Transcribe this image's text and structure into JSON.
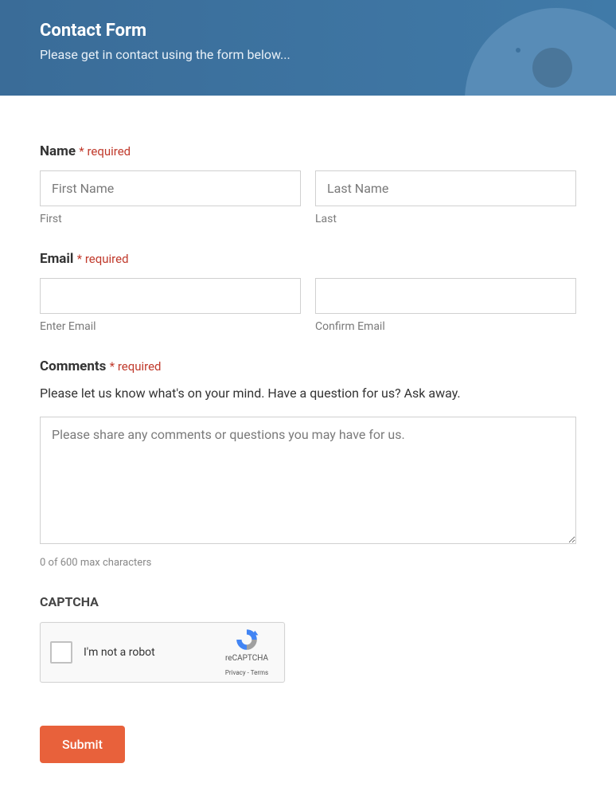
{
  "header": {
    "title": "Contact Form",
    "subtitle": "Please get in contact using the form below..."
  },
  "form": {
    "name": {
      "label": "Name",
      "required_text": "required",
      "first_placeholder": "First Name",
      "first_sublabel": "First",
      "last_placeholder": "Last Name",
      "last_sublabel": "Last"
    },
    "email": {
      "label": "Email",
      "required_text": "required",
      "enter_sublabel": "Enter Email",
      "confirm_sublabel": "Confirm Email"
    },
    "comments": {
      "label": "Comments",
      "required_text": "required",
      "description": "Please let us know what's on your mind. Have a question for us? Ask away.",
      "placeholder": "Please share any comments or questions you may have for us.",
      "char_counter": "0 of 600 max characters"
    },
    "captcha": {
      "label": "CAPTCHA",
      "checkbox_text": "I'm not a robot",
      "brand": "reCAPTCHA",
      "privacy": "Privacy",
      "terms": "Terms"
    },
    "submit_label": "Submit"
  }
}
